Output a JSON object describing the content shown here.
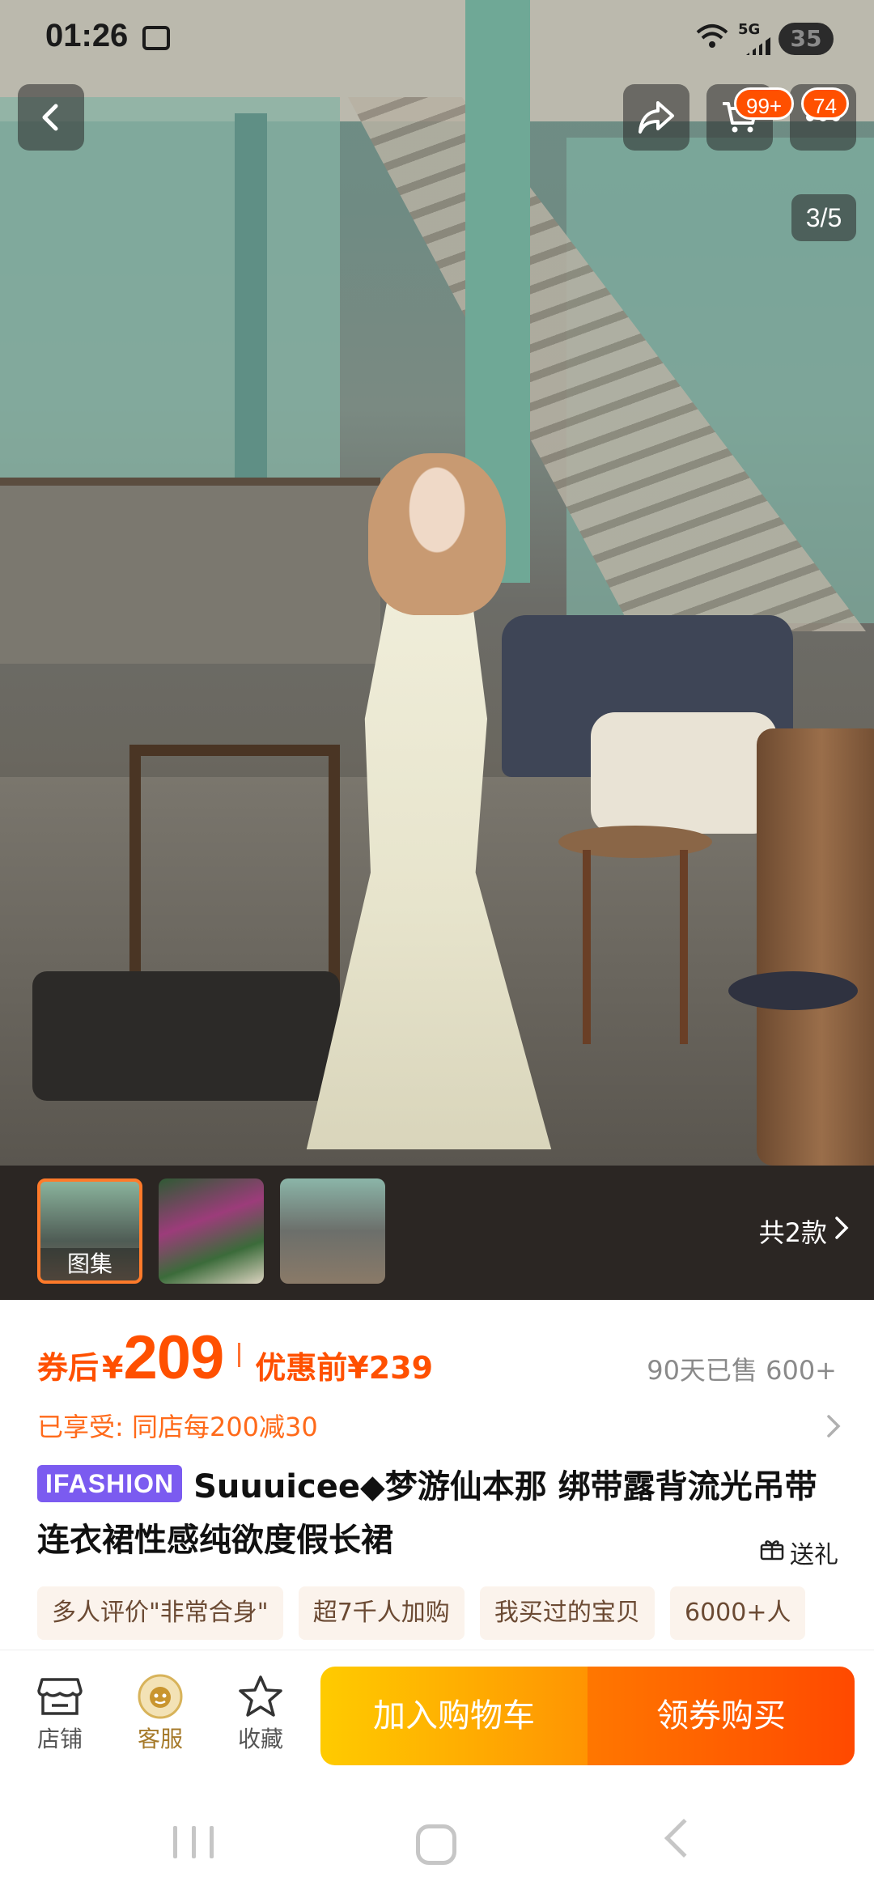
{
  "status_bar": {
    "time": "01:26",
    "network": "5G",
    "battery": "35"
  },
  "top_nav": {
    "cart_badge": "99+",
    "message_badge": "74",
    "image_index": "3/5"
  },
  "thumbnails": {
    "items": [
      {
        "label": "图集"
      },
      {
        "label": ""
      },
      {
        "label": ""
      }
    ],
    "variants_label": "共2款"
  },
  "price": {
    "after_coupon_label": "券后",
    "currency": "¥",
    "value": "209",
    "before_coupon": "优惠前¥239",
    "sold": "90天已售 600+"
  },
  "promo": {
    "text": "已享受: 同店每200减30"
  },
  "title": {
    "brand_tag": "IFASHION",
    "text": "Suuuicee◆梦游仙本那 绑带露背流光吊带连衣裙性感纯欲度假长裙",
    "gift_label": "送礼"
  },
  "tags": [
    "多人评价\"非常合身\"",
    "超7千人加购",
    "我买过的宝贝",
    "6000+人"
  ],
  "action_bar": {
    "shop_label": "店铺",
    "service_label": "客服",
    "favorite_label": "收藏",
    "add_to_cart_label": "加入购物车",
    "buy_label": "领券购买"
  },
  "colors": {
    "accent": "#ff5000",
    "brand_tag": "#7b5bf0",
    "cart_button": "#ffb300",
    "buy_button": "#ff5a00"
  },
  "icons": [
    "back-icon",
    "share-icon",
    "cart-icon",
    "more-icon",
    "chevron-right-icon",
    "gift-icon",
    "shop-icon",
    "service-icon",
    "star-icon"
  ]
}
